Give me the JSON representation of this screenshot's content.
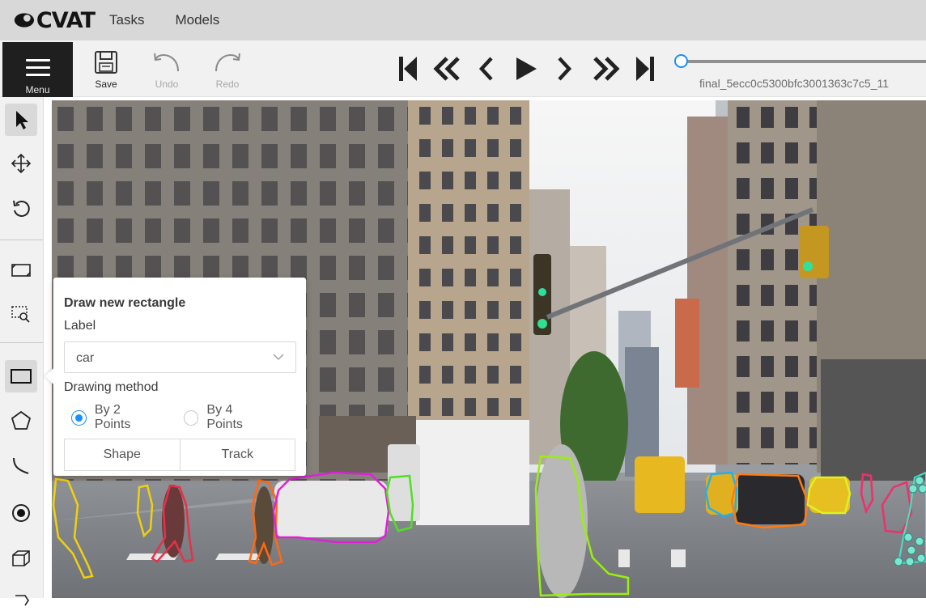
{
  "app": {
    "logo_text": "CVAT"
  },
  "nav": {
    "tasks": "Tasks",
    "models": "Models"
  },
  "toolbar": {
    "menu_label": "Menu",
    "save_label": "Save",
    "undo_label": "Undo",
    "redo_label": "Redo",
    "filename": "final_5ecc0c5300bfc3001363c7c5_11"
  },
  "player": {
    "frame_progress": 0
  },
  "draw_popover": {
    "title": "Draw new rectangle",
    "label_heading": "Label",
    "selected_label": "car",
    "method_heading": "Drawing method",
    "option_2_points": "By 2 Points",
    "option_4_points": "By 4 Points",
    "selected_method": "By 2 Points",
    "shape_button": "Shape",
    "track_button": "Track"
  },
  "annotation_colors": {
    "person_yellow": "#f0d010",
    "person_red": "#e8304a",
    "person_orange": "#ff6a10",
    "car_magenta": "#e020d8",
    "truck_green": "#50e020",
    "pedestrian_lime": "#9aee10",
    "car_blue": "#20b0f0",
    "car_orange": "#ff7a10",
    "car_yellow": "#e0f020",
    "person_pink": "#f0306a",
    "points_cyan": "#4ae0c0"
  },
  "accent_color": "#1890ff"
}
